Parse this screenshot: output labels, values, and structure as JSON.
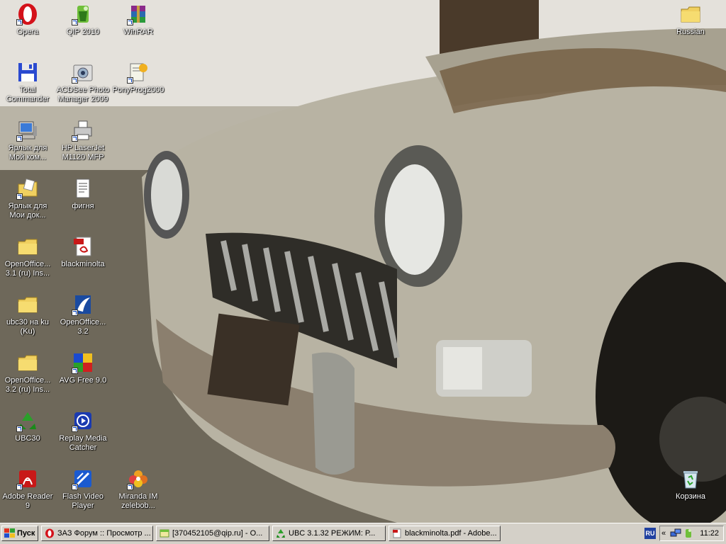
{
  "desktop": {
    "icons": [
      {
        "label": "Opera"
      },
      {
        "label": "QIP 2010"
      },
      {
        "label": "WinRAR"
      },
      {
        "label": "Total Commander"
      },
      {
        "label": "ACDSee Photo Manager 2009"
      },
      {
        "label": "PonyProg2000"
      },
      {
        "label": "Ярлык для Мой ком..."
      },
      {
        "label": "HP LaserJet M1120 MFP"
      },
      {
        "label": "Ярлык для Мои док..."
      },
      {
        "label": "фигня"
      },
      {
        "label": "OpenOffice... 3.1 (ru) Ins..."
      },
      {
        "label": "blackminolta"
      },
      {
        "label": "ubc30 на ku (Ku)"
      },
      {
        "label": "OpenOffice... 3.2"
      },
      {
        "label": "OpenOffice... 3.2 (ru) Ins..."
      },
      {
        "label": "AVG Free 9.0"
      },
      {
        "label": "UBC30"
      },
      {
        "label": "Replay Media Catcher"
      },
      {
        "label": "Adobe Reader 9"
      },
      {
        "label": "Flash Video Player"
      },
      {
        "label": "Miranda IM zelebob..."
      },
      {
        "label": "Russian"
      },
      {
        "label": "Корзина"
      }
    ]
  },
  "taskbar": {
    "start_label": "Пуск",
    "tasks": [
      {
        "label": "ЗАЗ Форум :: Просмотр ..."
      },
      {
        "label": "[370452105@qip.ru] - О..."
      },
      {
        "label": "UBC 3.1.32  РЕЖИМ: Р..."
      },
      {
        "label": "blackminolta.pdf - Adobe..."
      }
    ],
    "language": "RU",
    "chevron": "«",
    "clock": "11:22"
  }
}
